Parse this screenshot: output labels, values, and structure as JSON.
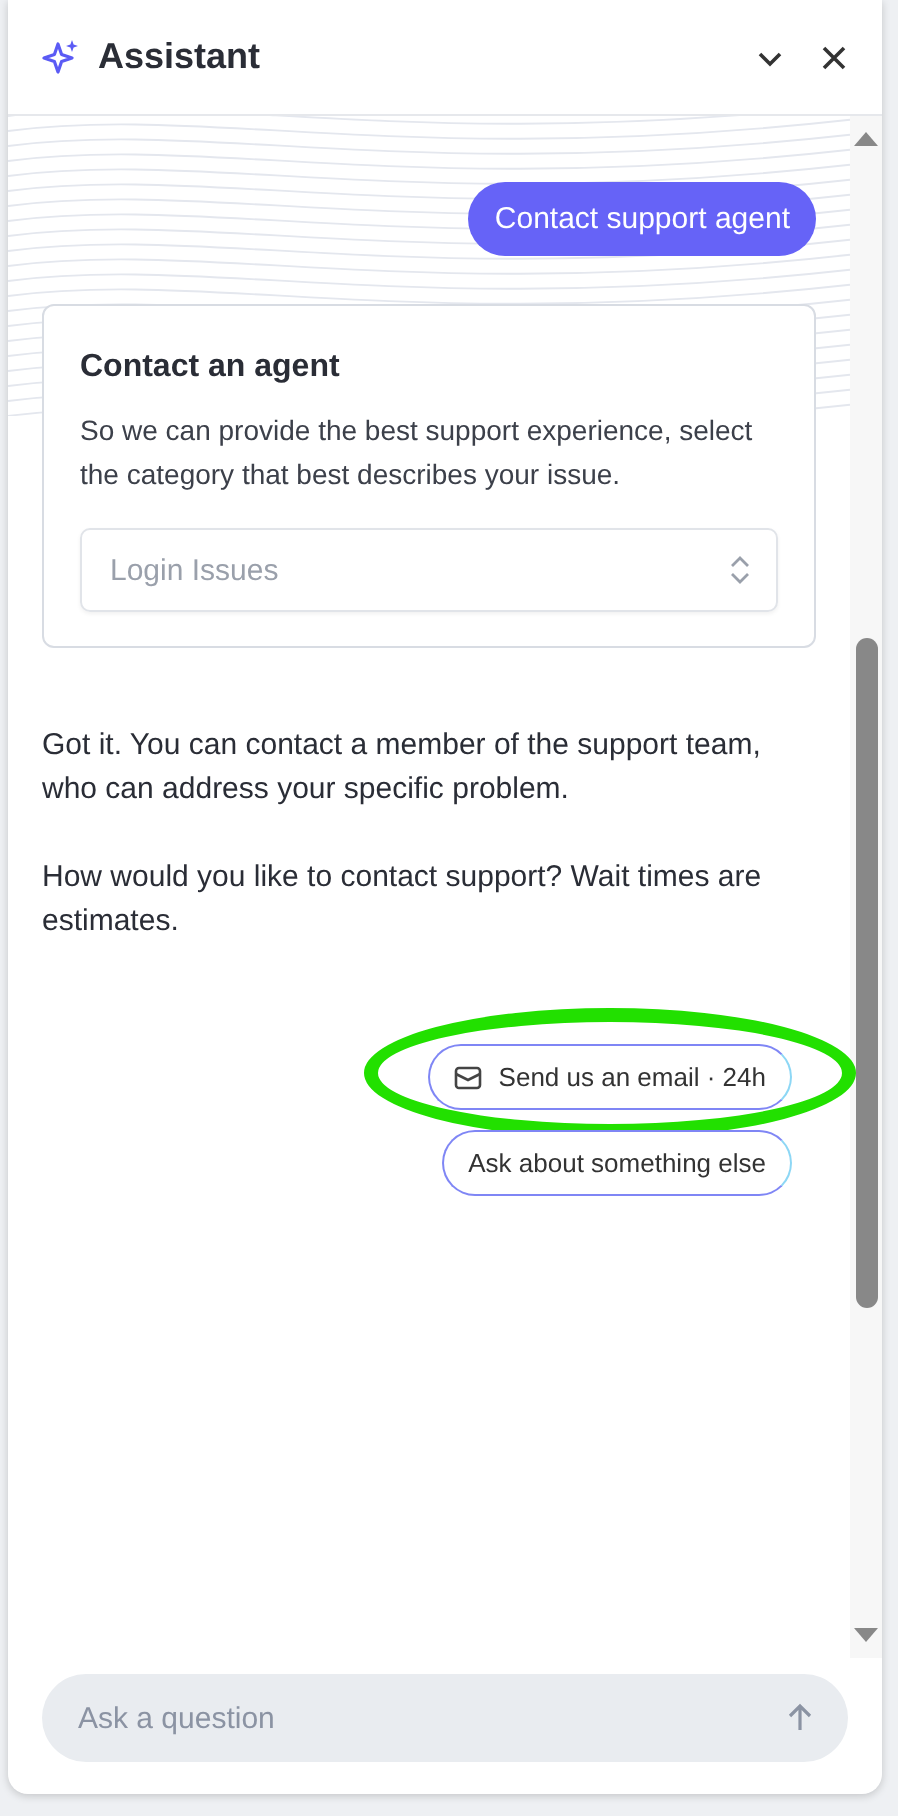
{
  "header": {
    "title": "Assistant"
  },
  "messages": [
    {
      "kind": "user",
      "text": "Contact support agent"
    },
    {
      "kind": "card",
      "title": "Contact an agent",
      "body": "So we can provide the best support experience, select the category that best describes your issue.",
      "select_value": "Login Issues"
    },
    {
      "kind": "bot",
      "text": "Got it. You can contact a member of the support team, who can address your specific problem."
    },
    {
      "kind": "bot",
      "text": "How would you like to contact support? Wait times are estimates."
    }
  ],
  "options": [
    {
      "label": "Send us an email · 24h",
      "kind": "email",
      "highlighted": true
    },
    {
      "label": "Ask about something else",
      "kind": "plain",
      "highlighted": false
    }
  ],
  "composer": {
    "placeholder": "Ask a question"
  }
}
